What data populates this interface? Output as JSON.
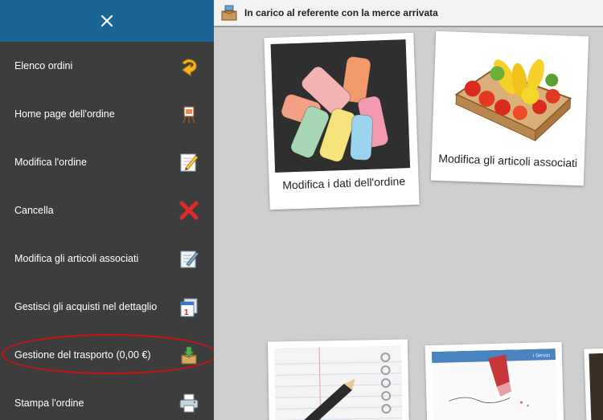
{
  "sidebar": {
    "close_label": "×",
    "items": [
      {
        "label": "Elenco ordini",
        "icon": "return-arrow-icon"
      },
      {
        "label": "Home page dell'ordine",
        "icon": "easel-icon"
      },
      {
        "label": "Modifica l'ordine",
        "icon": "notepad-pencil-icon"
      },
      {
        "label": "Cancella",
        "icon": "red-x-icon"
      },
      {
        "label": "Modifica gli articoli associati",
        "icon": "edit-document-icon"
      },
      {
        "label": "Gestisci gli acquisti nel dettaglio",
        "icon": "calendar-stack-icon"
      },
      {
        "label": "Gestione del trasporto (0,00 €)",
        "icon": "box-download-icon"
      },
      {
        "label": "Stampa l'ordine",
        "icon": "printer-icon"
      }
    ]
  },
  "header": {
    "title": "In carico al referente con la merce arrivata",
    "icon": "delivery-box-icon"
  },
  "cards": [
    {
      "caption": "Modifica i dati dell'ordine",
      "image": "chalk-photo"
    },
    {
      "caption": "Modifica gli articoli associati",
      "image": "fruit-crate-photo"
    },
    {
      "caption": "",
      "image": "notebook-pencil-photo"
    },
    {
      "caption": "",
      "image": "eraser-photo"
    },
    {
      "caption": "",
      "image": "partial-photo"
    }
  ],
  "eraser_photo_text": "i Servizi",
  "colors": {
    "sidebar_bg": "#3d3d3d",
    "close_bar_bg": "#1a6496",
    "content_bg": "#cfcfcf",
    "highlight": "#d01010"
  }
}
